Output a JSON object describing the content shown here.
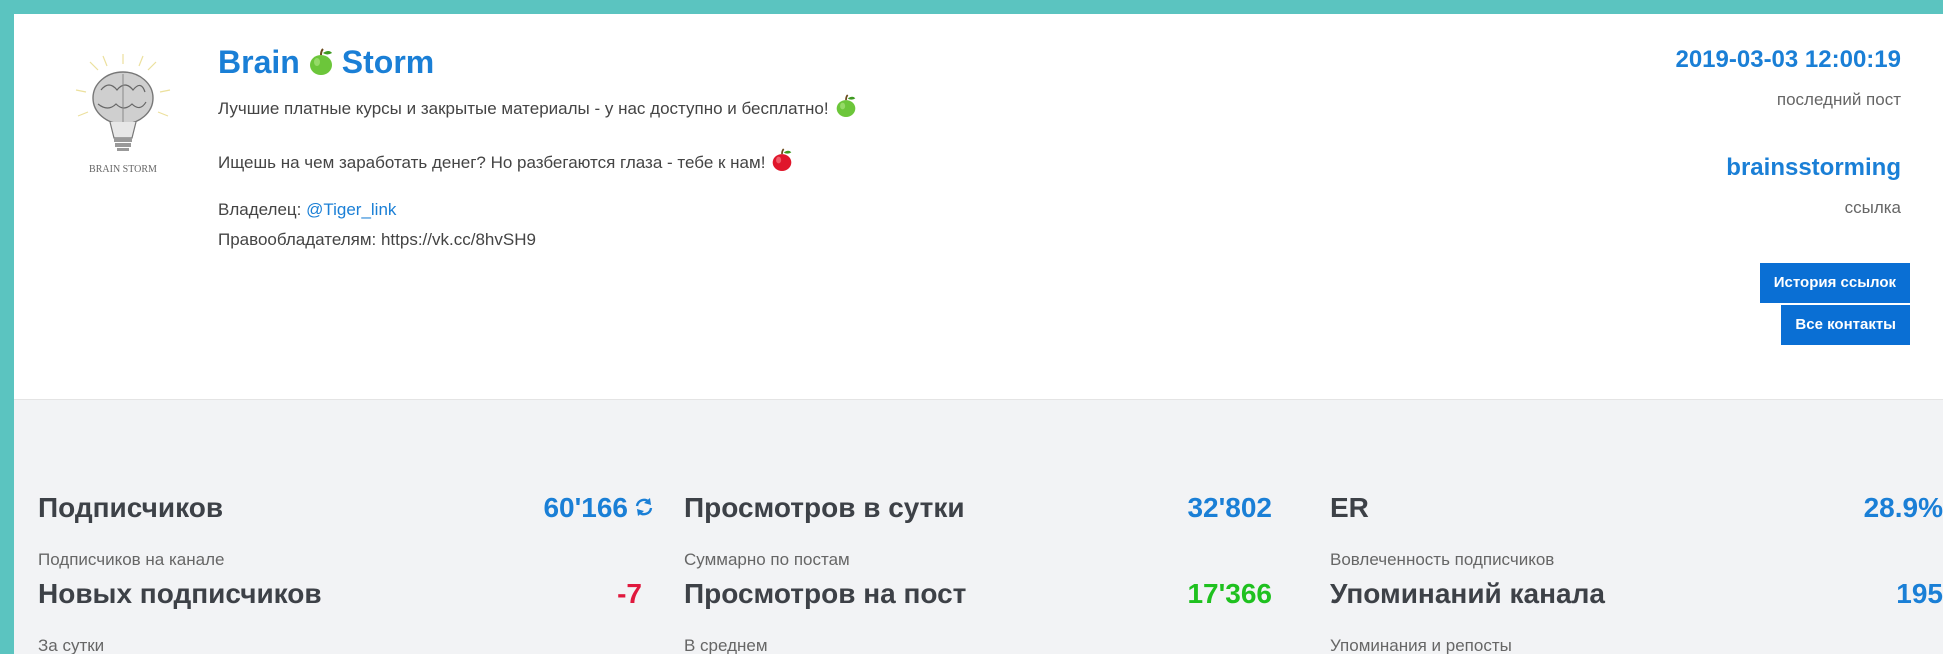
{
  "channel": {
    "title_part1": "Brain",
    "title_part2": "Storm",
    "logo_text": "BRAIN STORM",
    "line1": "Лучшие платные курсы и закрытые материалы - у нас доступно и бесплатно!",
    "line2": "Ищешь на чем заработать денег? Но разбегаются глаза - тебе к нам!",
    "owner_label": "Владелец:",
    "owner_handle": "@Tiger_link",
    "rights_label": "Правообладателям: https://vk.cc/8hvSH9"
  },
  "sidebar": {
    "last_post_date": "2019-03-03 12:00:19",
    "last_post_label": "последний пост",
    "username": "brainsstorming",
    "link_label": "ссылка",
    "history_button": "История ссылок",
    "contacts_button": "Все контакты"
  },
  "stats": {
    "subscribers": {
      "title": "Подписчиков",
      "sub": "Подписчиков на канале",
      "value": "60'166"
    },
    "new_subscribers": {
      "title": "Новых подписчиков",
      "sub": "За сутки",
      "value": "-7"
    },
    "views_day": {
      "title": "Просмотров в сутки",
      "sub": "Суммарно по постам",
      "value": "32'802"
    },
    "views_post": {
      "title": "Просмотров на пост",
      "sub": "В среднем",
      "value": "17'366"
    },
    "er": {
      "title": "ER",
      "sub": "Вовлеченность подписчиков",
      "value": "28.9%"
    },
    "mentions": {
      "title": "Упоминаний канала",
      "sub": "Упоминания и репосты",
      "value": "195"
    }
  },
  "colors": {
    "accent": "#1a7fd6",
    "button": "#0a6fd4",
    "negative": "#e0183d",
    "positive": "#1fc11f",
    "frame": "#5bc4c0"
  },
  "icons": {
    "logo": "lightbulb-brain-icon",
    "title_emoji": "green-apple-icon",
    "line1_emoji": "green-apple-icon",
    "line2_emoji": "red-apple-icon",
    "refresh": "refresh-icon"
  }
}
